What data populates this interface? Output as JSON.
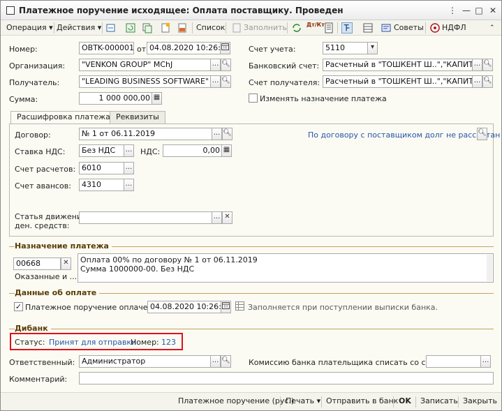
{
  "window": {
    "title": "Платежное поручение исходящее: Оплата поставщику. Проведен",
    "buttons": {
      "menu": "⋮",
      "minimize": "—",
      "maximize": "□",
      "close": "✕"
    }
  },
  "toolbar": {
    "operation": "Операция",
    "actions": "Действия",
    "list": "Список",
    "fill": "Заполнить",
    "dtkt": "Дт/Кт",
    "tips": "Советы",
    "ndfl": "НДФЛ"
  },
  "header": {
    "number_label": "Номер:",
    "number_value": "OBTK-000001",
    "date_from_label": "от",
    "date_value": "04.08.2020 10:26:53",
    "org_label": "Организация:",
    "org_value": "\"VENKON GROUP\" MChJ",
    "recipient_label": "Получатель:",
    "recipient_value": "\"LEADING BUSINESS SOFTWARE\" M",
    "sum_label": "Сумма:",
    "sum_value": "1 000 000,00",
    "account_label": "Счет учета:",
    "account_value": "5110",
    "bank_account_label": "Банковский счет:",
    "bank_account_value": "Расчетный в \"ТОШКЕНТ Ш..\",\"КАПИТАЛБ..",
    "recipient_account_label": "Счет получателя:",
    "recipient_account_value": "Расчетный в \"ТОШКЕНТ Ш..\",\"КАПИТАЛБ..",
    "change_purpose_label": "Изменять назначение платежа"
  },
  "tabs": [
    {
      "label": "Расшифровка платежа"
    },
    {
      "label": "Реквизиты"
    }
  ],
  "breakdown": {
    "contract_label": "Договор:",
    "contract_value": "№ 1 от 06.11.2019",
    "contract_link": "По договору с поставщиком долг не рассчитан",
    "vat_rate_label": "Ставка НДС:",
    "vat_rate_value": "Без НДС",
    "vat_label": "НДС:",
    "vat_value": "0,00",
    "settlement_account_label": "Счет расчетов:",
    "settlement_account_value": "6010",
    "advance_account_label": "Счет авансов:",
    "advance_account_value": "4310",
    "cashflow_label_1": "Статья движения",
    "cashflow_label_2": "ден. средств:",
    "cashflow_value": ""
  },
  "purpose": {
    "title": "Назначение платежа",
    "code_value": "00668",
    "code_caption": "Оказанные и ...",
    "text_line1": "Оплата 00% по договору № 1 от 06.11.2019",
    "text_line2": "Сумма 1000000-00. Без НДС"
  },
  "payment": {
    "title": "Данные об оплате",
    "paid_label": "Платежное поручение оплачено:",
    "paid_date": "04.08.2020 10:26:53",
    "hint": "Заполняется при поступлении выписки банка."
  },
  "dibank": {
    "title": "Дибанк",
    "status_label": "Статус:",
    "status_value": "Принят для отправки",
    "number_label": "Номер:",
    "number_value": "123"
  },
  "footer_fields": {
    "responsible_label": "Ответственный:",
    "responsible_value": "Администратор",
    "commission_label": "Комиссию банка плательщика списать со счета:",
    "commission_value": "",
    "comment_label": "Комментарий:",
    "comment_value": ""
  },
  "statusbar": {
    "print_form": "Платежное поручение (рус.)",
    "print": "Печать",
    "send_bank": "Отправить в банк",
    "ok": "OK",
    "save": "Записать",
    "close": "Закрыть"
  },
  "colors": {
    "accent_group": "#5a3c00",
    "link": "#2656a8",
    "highlight_box": "#e0101a"
  }
}
